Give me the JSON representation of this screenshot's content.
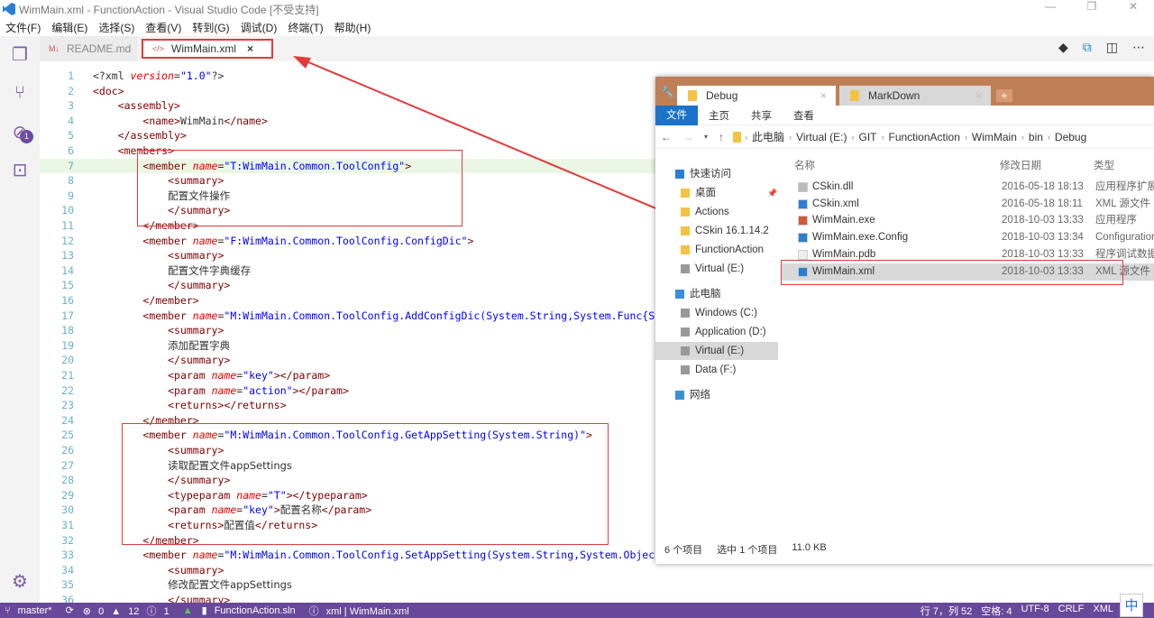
{
  "window": {
    "title": "WimMain.xml - FunctionAction - Visual Studio Code [不受支持]",
    "controls": [
      "—",
      "❐",
      "✕"
    ]
  },
  "menu": [
    "文件(F)",
    "编辑(E)",
    "选择(S)",
    "查看(V)",
    "转到(G)",
    "调试(D)",
    "终端(T)",
    "帮助(H)"
  ],
  "activity": {
    "scm_badge": "1"
  },
  "tabs": [
    {
      "label": "README.md",
      "icon": "markdown-icon"
    },
    {
      "label": "WimMain.xml",
      "icon": "xml-icon",
      "close": "×"
    }
  ],
  "editor": {
    "current_line": 7,
    "lines": [
      [
        [
          "x",
          "<?xml "
        ],
        [
          "a",
          "version"
        ],
        [
          "x",
          "="
        ],
        [
          "s",
          "\"1.0\""
        ],
        [
          "x",
          "?>"
        ]
      ],
      [
        [
          "t",
          "<doc>"
        ]
      ],
      [
        [
          "x",
          "    "
        ],
        [
          "t",
          "<assembly>"
        ]
      ],
      [
        [
          "x",
          "        "
        ],
        [
          "t",
          "<name>"
        ],
        [
          "x",
          "WimMain"
        ],
        [
          "t",
          "</name>"
        ]
      ],
      [
        [
          "x",
          "    "
        ],
        [
          "t",
          "</assembly>"
        ]
      ],
      [
        [
          "x",
          "    "
        ],
        [
          "t",
          "<members>"
        ]
      ],
      [
        [
          "x",
          "        "
        ],
        [
          "t",
          "<member "
        ],
        [
          "a",
          "name"
        ],
        [
          "x",
          "="
        ],
        [
          "s",
          "\"T:WimMain.Common.ToolConfig\""
        ],
        [
          "t",
          ">"
        ]
      ],
      [
        [
          "x",
          "            "
        ],
        [
          "t",
          "<summary>"
        ]
      ],
      [
        [
          "x",
          "            "
        ],
        [
          "p",
          "配置文件操作"
        ]
      ],
      [
        [
          "x",
          "            "
        ],
        [
          "t",
          "</summary>"
        ]
      ],
      [
        [
          "x",
          "        "
        ],
        [
          "t",
          "</member>"
        ]
      ],
      [
        [
          "x",
          "        "
        ],
        [
          "t",
          "<member "
        ],
        [
          "a",
          "name"
        ],
        [
          "x",
          "="
        ],
        [
          "s",
          "\"F:WimMain.Common.ToolConfig.ConfigDic\""
        ],
        [
          "t",
          ">"
        ]
      ],
      [
        [
          "x",
          "            "
        ],
        [
          "t",
          "<summary>"
        ]
      ],
      [
        [
          "x",
          "            "
        ],
        [
          "p",
          "配置文件字典缓存"
        ]
      ],
      [
        [
          "x",
          "            "
        ],
        [
          "t",
          "</summary>"
        ]
      ],
      [
        [
          "x",
          "        "
        ],
        [
          "t",
          "</member>"
        ]
      ],
      [
        [
          "x",
          "        "
        ],
        [
          "t",
          "<member "
        ],
        [
          "a",
          "name"
        ],
        [
          "x",
          "="
        ],
        [
          "s",
          "\"M:WimMain.Common.ToolConfig.AddConfigDic(System.String,System.Func{Sys"
        ]
      ],
      [
        [
          "x",
          "            "
        ],
        [
          "t",
          "<summary>"
        ]
      ],
      [
        [
          "x",
          "            "
        ],
        [
          "p",
          "添加配置字典"
        ]
      ],
      [
        [
          "x",
          "            "
        ],
        [
          "t",
          "</summary>"
        ]
      ],
      [
        [
          "x",
          "            "
        ],
        [
          "t",
          "<param "
        ],
        [
          "a",
          "name"
        ],
        [
          "x",
          "="
        ],
        [
          "s",
          "\"key\""
        ],
        [
          "t",
          "></param>"
        ]
      ],
      [
        [
          "x",
          "            "
        ],
        [
          "t",
          "<param "
        ],
        [
          "a",
          "name"
        ],
        [
          "x",
          "="
        ],
        [
          "s",
          "\"action\""
        ],
        [
          "t",
          "></param>"
        ]
      ],
      [
        [
          "x",
          "            "
        ],
        [
          "t",
          "<returns></returns>"
        ]
      ],
      [
        [
          "x",
          "        "
        ],
        [
          "t",
          "</member>"
        ]
      ],
      [
        [
          "x",
          "        "
        ],
        [
          "t",
          "<member "
        ],
        [
          "a",
          "name"
        ],
        [
          "x",
          "="
        ],
        [
          "s",
          "\"M:WimMain.Common.ToolConfig.GetAppSetting(System.String)\""
        ],
        [
          "t",
          ">"
        ]
      ],
      [
        [
          "x",
          "            "
        ],
        [
          "t",
          "<summary>"
        ]
      ],
      [
        [
          "x",
          "            "
        ],
        [
          "p",
          "读取配置文件appSettings"
        ]
      ],
      [
        [
          "x",
          "            "
        ],
        [
          "t",
          "</summary>"
        ]
      ],
      [
        [
          "x",
          "            "
        ],
        [
          "t",
          "<typeparam "
        ],
        [
          "a",
          "name"
        ],
        [
          "x",
          "="
        ],
        [
          "s",
          "\"T\""
        ],
        [
          "t",
          "></typeparam>"
        ]
      ],
      [
        [
          "x",
          "            "
        ],
        [
          "t",
          "<param "
        ],
        [
          "a",
          "name"
        ],
        [
          "x",
          "="
        ],
        [
          "s",
          "\"key\""
        ],
        [
          "t",
          ">"
        ],
        [
          "p",
          "配置名称"
        ],
        [
          "t",
          "</param>"
        ]
      ],
      [
        [
          "x",
          "            "
        ],
        [
          "t",
          "<returns>"
        ],
        [
          "p",
          "配置值"
        ],
        [
          "t",
          "</returns>"
        ]
      ],
      [
        [
          "x",
          "        "
        ],
        [
          "t",
          "</member>"
        ]
      ],
      [
        [
          "x",
          "        "
        ],
        [
          "t",
          "<member "
        ],
        [
          "a",
          "name"
        ],
        [
          "x",
          "="
        ],
        [
          "s",
          "\"M:WimMain.Common.ToolConfig.SetAppSetting(System.String,System.Object)\""
        ],
        [
          "t",
          ">"
        ]
      ],
      [
        [
          "x",
          "            "
        ],
        [
          "t",
          "<summary>"
        ]
      ],
      [
        [
          "x",
          "            "
        ],
        [
          "p",
          "修改配置文件appSettings"
        ]
      ],
      [
        [
          "x",
          "            "
        ],
        [
          "t",
          "</summary>"
        ]
      ]
    ]
  },
  "status": {
    "branch": "master*",
    "sync": "⟳",
    "errors": "0",
    "warnings": "12",
    "info": "1",
    "solution": "FunctionAction.sln",
    "lang_scope": "xml | WimMain.xml",
    "position": "行 7，列 52",
    "spaces": "空格: 4",
    "encoding": "UTF-8",
    "eol": "CRLF",
    "lang": "XML",
    "ime": "中"
  },
  "explorer": {
    "tabs": [
      {
        "label": "Debug",
        "close": "×"
      },
      {
        "label": "MarkDown",
        "close": "×"
      }
    ],
    "new_tab": "+",
    "ribbon": [
      "文件",
      "主页",
      "共享",
      "查看"
    ],
    "breadcrumb": [
      "此电脑",
      "Virtual (E:)",
      "GIT",
      "FunctionAction",
      "WimMain",
      "bin",
      "Debug"
    ],
    "nav": [
      {
        "label": "快速访问",
        "icon": "star-icon",
        "indent": 0
      },
      {
        "label": "桌面",
        "icon": "folder-icon",
        "indent": 1,
        "pinned": true
      },
      {
        "label": "Actions",
        "icon": "folder-icon",
        "indent": 1
      },
      {
        "label": "CSkin 16.1.14.2",
        "icon": "folder-icon",
        "indent": 1
      },
      {
        "label": "FunctionAction",
        "icon": "folder-icon",
        "indent": 1
      },
      {
        "label": "Virtual (E:)",
        "icon": "drive-icon",
        "indent": 1
      },
      {
        "label": "此电脑",
        "icon": "pc-icon",
        "indent": 0
      },
      {
        "label": "Windows (C:)",
        "icon": "drive-icon",
        "indent": 1
      },
      {
        "label": "Application (D:)",
        "icon": "drive-icon",
        "indent": 1
      },
      {
        "label": "Virtual (E:)",
        "icon": "drive-icon",
        "indent": 1,
        "selected": true
      },
      {
        "label": "Data (F:)",
        "icon": "drive-icon",
        "indent": 1
      },
      {
        "label": "网络",
        "icon": "network-icon",
        "indent": 0
      }
    ],
    "columns": [
      "名称",
      "修改日期",
      "类型"
    ],
    "files": [
      {
        "name": "CSkin.dll",
        "date": "2016-05-18 18:13",
        "type": "应用程序扩展",
        "icon": "dll-icon"
      },
      {
        "name": "CSkin.xml",
        "date": "2016-05-18 18:11",
        "type": "XML 源文件",
        "icon": "xml-file-icon"
      },
      {
        "name": "WimMain.exe",
        "date": "2018-10-03 13:33",
        "type": "应用程序",
        "icon": "exe-icon"
      },
      {
        "name": "WimMain.exe.Config",
        "date": "2018-10-03 13:34",
        "type": "Configuration",
        "icon": "xml-file-icon"
      },
      {
        "name": "WimMain.pdb",
        "date": "2018-10-03 13:33",
        "type": "程序调试数据库",
        "icon": "file-icon"
      },
      {
        "name": "WimMain.xml",
        "date": "2018-10-03 13:33",
        "type": "XML 源文件",
        "icon": "xml-file-icon",
        "selected": true
      }
    ],
    "status": {
      "count": "6 个项目",
      "selected": "选中 1 个项目",
      "size": "11.0 KB"
    }
  },
  "colors": {
    "status_bar": "#68489a",
    "annotation_red": "#e23b3b",
    "explorer_title": "#bf7f56",
    "ribbon_file": "#1a73c9"
  }
}
